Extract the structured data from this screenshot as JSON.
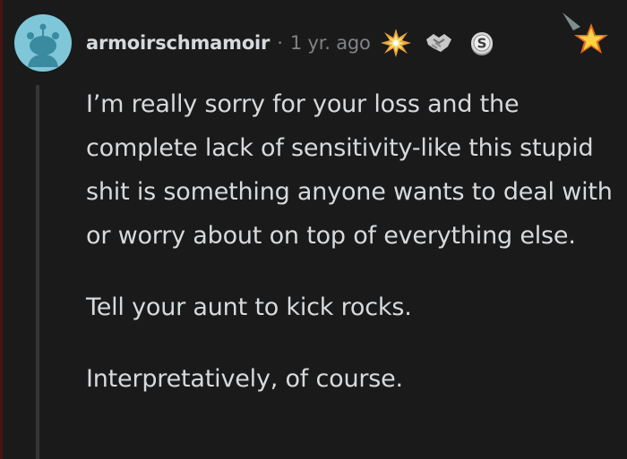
{
  "comment": {
    "username": "armoirschmamoir",
    "separator": "·",
    "timestamp": "1 yr. ago",
    "awards": [
      "explosion-award-icon",
      "handshake-award-icon",
      "silver-coin-award-icon"
    ],
    "corner_award": "star-award-icon",
    "paragraphs": [
      "I’m really sorry for your loss and the complete lack of sensitivity-like this stupid shit is something anyone wants to deal with or worry about on top of everything else.",
      "Tell your aunt to kick rocks.",
      "Interpretatively, of course."
    ]
  },
  "colors": {
    "background": "#1a1a1b",
    "text": "#d7dadc",
    "muted": "#818384",
    "avatar": "#7fc6d8",
    "thread_line": "#343536"
  }
}
